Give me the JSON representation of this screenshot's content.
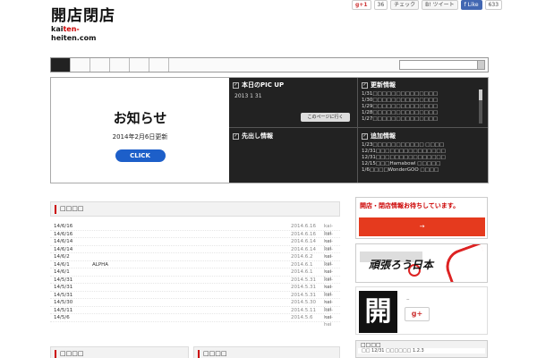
{
  "header": {
    "logo_main": "開店閉店",
    "logo_sub_a": "kai",
    "logo_sub_sep": "ten-",
    "logo_sub_b": "heiten.com",
    "social": {
      "gplus": "g+1",
      "count1": "36",
      "check": "チェック",
      "hatena": "B! ツイート",
      "facebook": "f Like",
      "count2": "633"
    }
  },
  "search": {
    "placeholder": ""
  },
  "banner": {
    "oshirase_title": "お知らせ",
    "oshirase_date": "2014年2月6日更新",
    "click_label": "CLICK",
    "pickup_title": "本日のPIC UP",
    "pickup_date": "2013  1  31",
    "pickup_button": "このページに行く",
    "update_title": "更新情報",
    "update_items": [
      "1/31□□□□□□□□□□□□□□",
      "1/30□□□□□□□□□□□□□□",
      "1/29□□□□□□□□□□□□□□",
      "1/28□□□□□□□□□□□□□□",
      "1/27□□□□□□□□□□□□□□"
    ],
    "sakidashi_title": "先出し情報",
    "add_title": "追加情報",
    "add_items": [
      "1/23□□□□□□□□□□□ □□□□",
      "12/31□□□□□□□□□□□□□□□",
      "12/31□□□□□□□□□□□□□□□",
      "12/15□□□Hamabowl □□□□□",
      "1/6□□□□WonderGOO □□□□"
    ]
  },
  "news": {
    "section_title": "□□□□",
    "rows": [
      {
        "date": "14/6/16",
        "title": "",
        "date2": "2014.6.16",
        "cat": "kai-hei"
      },
      {
        "date": "14/6/16",
        "title": "",
        "date2": "2014.6.16",
        "cat": "kai-hei"
      },
      {
        "date": "14/6/14",
        "title": "",
        "date2": "2014.6.14",
        "cat": "kai-hei"
      },
      {
        "date": "14/6/14",
        "title": "",
        "date2": "2014.6.14",
        "cat": "kai-hei"
      },
      {
        "date": "14/6/2",
        "title": "",
        "date2": "2014.6.2",
        "cat": "kai-hei"
      },
      {
        "date": "14/6/1",
        "title": "ALPHA",
        "date2": "2014.6.1",
        "cat": "kai-hei"
      },
      {
        "date": "14/6/1",
        "title": "",
        "date2": "2014.6.1",
        "cat": "kai-hei"
      },
      {
        "date": "14/5/31",
        "title": "",
        "date2": "2014.5.31",
        "cat": "kai-hei"
      },
      {
        "date": "14/5/31",
        "title": "",
        "date2": "2014.5.31",
        "cat": "kai-hei"
      },
      {
        "date": "14/5/31",
        "title": "",
        "date2": "2014.5.31",
        "cat": "kai-hei"
      },
      {
        "date": "14/5/30",
        "title": "",
        "date2": "2014.5.30",
        "cat": "kai-hei"
      },
      {
        "date": "14/5/11",
        "title": "",
        "date2": "2014.5.11",
        "cat": "kai-hei"
      },
      {
        "date": "14/5/6",
        "title": "",
        "date2": "2014.5.6",
        "cat": "kai-hei"
      }
    ],
    "bottom_left_title": "□□□□",
    "bottom_right_title": "□□□□"
  },
  "sidebar": {
    "open_close_title": "開店・閉店情報お待ちしています。",
    "red_button": "→",
    "banner_title": "頑張ろう日本",
    "kanji": "開",
    "dash": "–",
    "gplus": "g+",
    "box_head": "□□□□",
    "box_row": "□□ 12/31 □□□□□□ 1.2.3"
  },
  "colors": {
    "accent_red": "#e53a1e",
    "click_blue": "#1d5fc9",
    "dark_panel": "#222222",
    "facebook": "#4267b2"
  }
}
